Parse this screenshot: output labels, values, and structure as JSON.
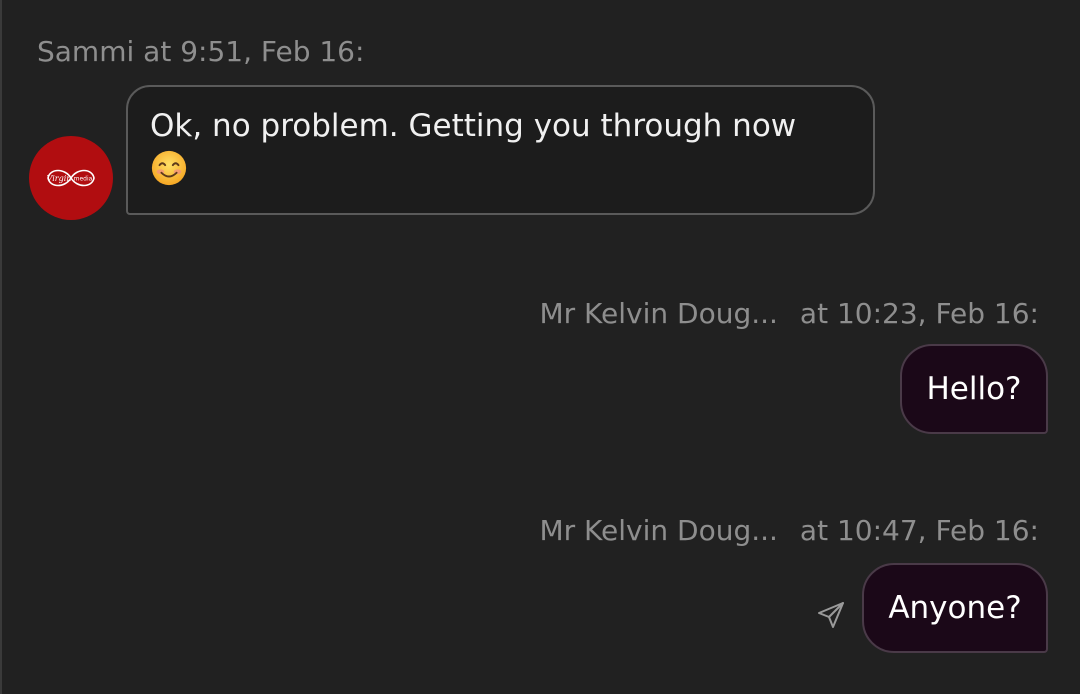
{
  "messages": [
    {
      "sender": "Sammi",
      "timestamp": "at 9:51, Feb 16:",
      "text": "Ok, no problem. Getting you through now",
      "emoji": "smiling-face-icon",
      "avatar": {
        "brand": "Virgin media",
        "brand_script": "Virgin",
        "brand_word": "media",
        "color": "#b10d10"
      }
    },
    {
      "sender": "Mr Kelvin Doug...",
      "timestamp": "at 10:23, Feb 16:",
      "text": "Hello?"
    },
    {
      "sender": "Mr Kelvin Doug...",
      "timestamp": "at 10:47, Feb 16:",
      "text": "Anyone?",
      "status_icon": "send-icon"
    }
  ],
  "colors": {
    "background": "#212121",
    "agent_bubble_border": "#5a5a5a",
    "user_bubble": "#1b0818",
    "meta_text": "#8e8e8e"
  }
}
